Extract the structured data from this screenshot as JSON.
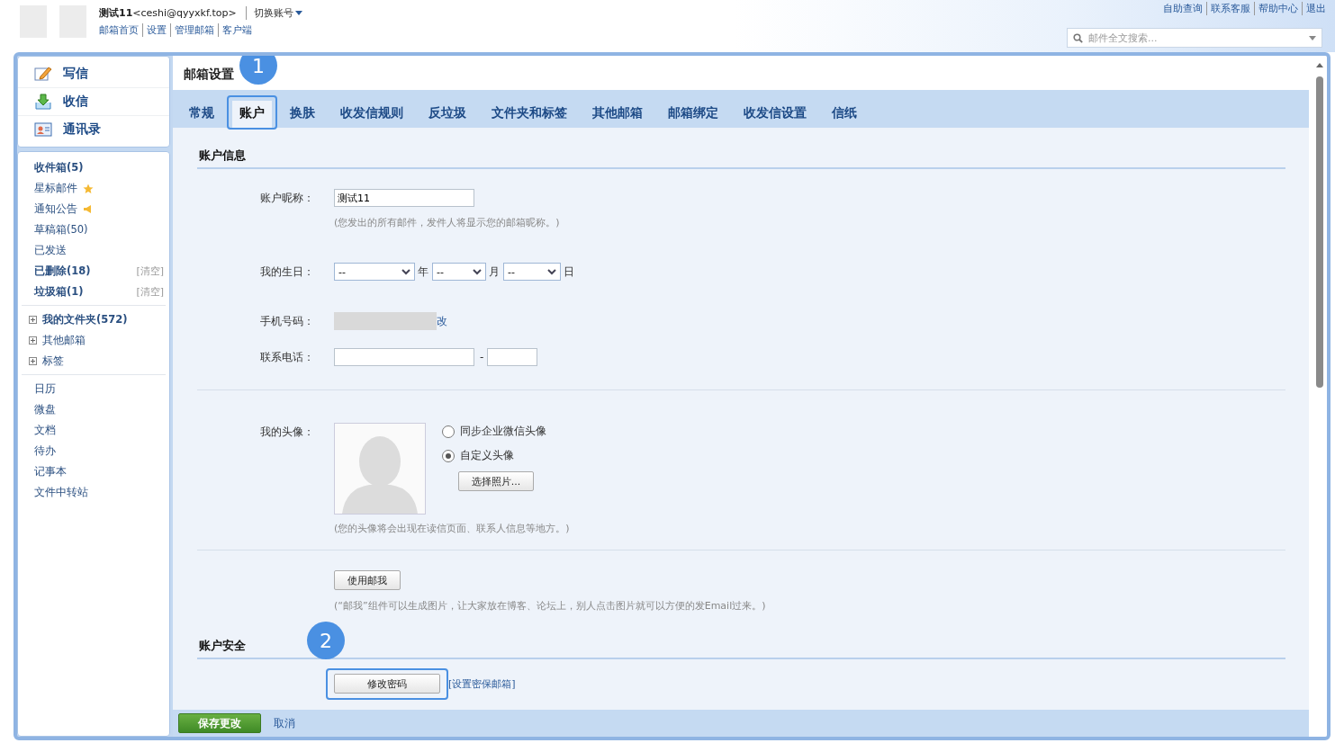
{
  "header": {
    "user_name": "测试11",
    "user_email": "<ceshi@qyyxkf.top>",
    "switch_account": "切换账号",
    "links": [
      "邮箱首页",
      "设置",
      "管理邮箱",
      "客户端"
    ],
    "top_links": [
      "自助查询",
      "联系客服",
      "帮助中心",
      "退出"
    ],
    "search": {
      "placeholder": "邮件全文搜索..."
    }
  },
  "sidebar": {
    "quick": [
      {
        "label": "写信",
        "kind": "compose"
      },
      {
        "label": "收信",
        "kind": "receive"
      },
      {
        "label": "通讯录",
        "kind": "contacts"
      }
    ],
    "folders": [
      {
        "label": "收件箱(5)",
        "bold": true
      },
      {
        "label": "星标邮件",
        "bold": false,
        "kind": "star"
      },
      {
        "label": "通知公告",
        "bold": false,
        "kind": "notice"
      },
      {
        "label": "草稿箱(50)",
        "bold": false
      },
      {
        "label": "已发送",
        "bold": false
      },
      {
        "label": "已删除(18)",
        "bold": true,
        "action": "[清空]"
      },
      {
        "label": "垃圾箱(1)",
        "bold": true,
        "action": "[清空]"
      }
    ],
    "groups": [
      {
        "label": "我的文件夹(572)",
        "bold": true,
        "expanded": false
      },
      {
        "label": "其他邮箱",
        "bold": false,
        "expanded": false
      },
      {
        "label": "标签",
        "bold": false,
        "expanded": false
      }
    ],
    "apps": [
      "日历",
      "微盘",
      "文档",
      "待办",
      "记事本",
      "文件中转站"
    ]
  },
  "page_title": "邮箱设置",
  "tabs": [
    {
      "label": "常规",
      "selected": false
    },
    {
      "label": "账户",
      "selected": true,
      "badge": "1"
    },
    {
      "label": "换肤",
      "selected": false
    },
    {
      "label": "收发信规则",
      "selected": false
    },
    {
      "label": "反垃圾",
      "selected": false
    },
    {
      "label": "文件夹和标签",
      "selected": false
    },
    {
      "label": "其他邮箱",
      "selected": false
    },
    {
      "label": "邮箱绑定",
      "selected": false
    },
    {
      "label": "收发信设置",
      "selected": false
    },
    {
      "label": "信纸",
      "selected": false
    }
  ],
  "account_info": {
    "title": "账户信息",
    "nickname": {
      "label": "账户昵称：",
      "value": "测试11",
      "hint": "(您发出的所有邮件，发件人将显示您的邮箱昵称。)"
    },
    "birthday": {
      "label": "我的生日：",
      "selects": [
        {
          "value": "--",
          "unit": "年"
        },
        {
          "value": "--",
          "unit": "月"
        },
        {
          "value": "--",
          "unit": "日"
        }
      ]
    },
    "mobile": {
      "label": "手机号码：",
      "link": "改"
    },
    "phone": {
      "label": "联系电话：",
      "separator": "-"
    },
    "avatar": {
      "label": "我的头像：",
      "options": [
        {
          "label": "同步企业微信头像",
          "selected": false
        },
        {
          "label": "自定义头像",
          "selected": true
        }
      ],
      "button": "选择照片...",
      "hint": "(您的头像将会出现在读信页面、联系人信息等地方。)"
    },
    "mail_me": {
      "button": "使用邮我",
      "hint": "(“邮我”组件可以生成图片，让大家放在博客、论坛上，别人点击图片就可以方便的发Email过来。)"
    }
  },
  "security": {
    "title": "账户安全",
    "button": "修改密码",
    "badge": "2",
    "link": "[设置密保邮箱]"
  },
  "footer": {
    "save": "保存更改",
    "cancel": "取消"
  }
}
